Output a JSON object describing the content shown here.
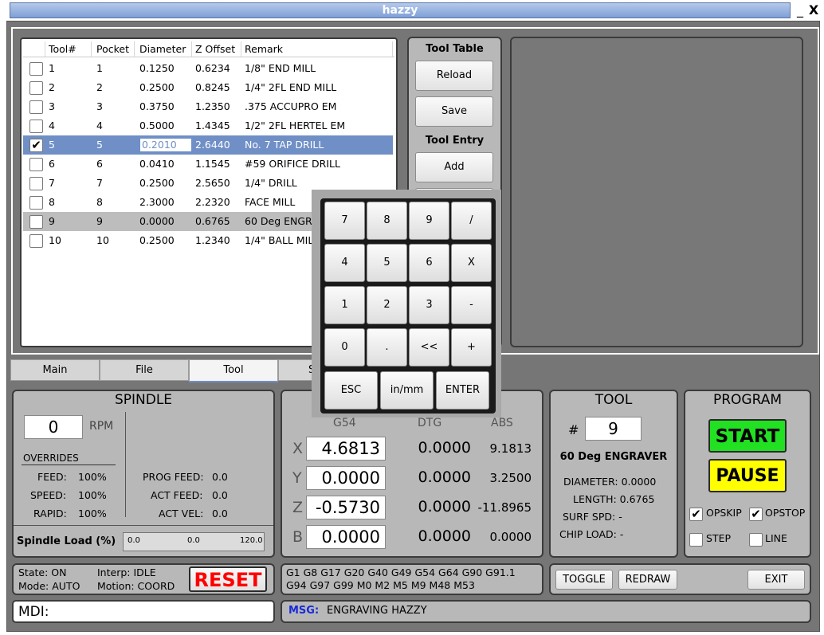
{
  "window": {
    "title": "hazzy",
    "minimize": "_",
    "close": "X"
  },
  "tool_table": {
    "headers": [
      "Tool#",
      "Pocket",
      "Diameter",
      "Z Offset",
      "Remark"
    ],
    "rows": [
      {
        "checked": false,
        "tool": "1",
        "pocket": "1",
        "diameter": "0.1250",
        "zoffset": "0.6234",
        "remark": "1/8\" END MILL"
      },
      {
        "checked": false,
        "tool": "2",
        "pocket": "2",
        "diameter": "0.2500",
        "zoffset": "0.8245",
        "remark": "1/4\" 2FL END MILL"
      },
      {
        "checked": false,
        "tool": "3",
        "pocket": "3",
        "diameter": "0.3750",
        "zoffset": "1.2350",
        "remark": ".375 ACCUPRO EM"
      },
      {
        "checked": false,
        "tool": "4",
        "pocket": "4",
        "diameter": "0.5000",
        "zoffset": "1.4345",
        "remark": "1/2\" 2FL HERTEL EM"
      },
      {
        "checked": true,
        "tool": "5",
        "pocket": "5",
        "diameter": "0.2010",
        "zoffset": "2.6440",
        "remark": "No. 7 TAP DRILL"
      },
      {
        "checked": false,
        "tool": "6",
        "pocket": "6",
        "diameter": "0.0410",
        "zoffset": "1.1545",
        "remark": "#59 ORIFICE DRILL"
      },
      {
        "checked": false,
        "tool": "7",
        "pocket": "7",
        "diameter": "0.2500",
        "zoffset": "2.5650",
        "remark": "1/4\" DRILL"
      },
      {
        "checked": false,
        "tool": "8",
        "pocket": "8",
        "diameter": "2.3000",
        "zoffset": "2.2320",
        "remark": "FACE MILL"
      },
      {
        "checked": false,
        "tool": "9",
        "pocket": "9",
        "diameter": "0.0000",
        "zoffset": "0.6765",
        "remark": "60 Deg ENGRAVER"
      },
      {
        "checked": false,
        "tool": "10",
        "pocket": "10",
        "diameter": "0.2500",
        "zoffset": "1.2340",
        "remark": "1/4\" BALL MILL"
      }
    ]
  },
  "tool_buttons": {
    "table_label": "Tool Table",
    "reload": "Reload",
    "save": "Save",
    "entry_label": "Tool Entry",
    "add": "Add"
  },
  "tabs": [
    "Main",
    "File",
    "Tool",
    "S"
  ],
  "keypad": {
    "rows": [
      [
        "7",
        "8",
        "9",
        "/"
      ],
      [
        "4",
        "5",
        "6",
        "X"
      ],
      [
        "1",
        "2",
        "3",
        "-"
      ],
      [
        "0",
        ".",
        "<<",
        "+"
      ]
    ],
    "bottom": [
      "ESC",
      "in/mm",
      "ENTER"
    ]
  },
  "spindle": {
    "title": "SPINDLE",
    "rpm_value": "0",
    "rpm_unit": "RPM",
    "overrides_label": "OVERRIDES",
    "feed_label": "FEED:",
    "feed_value": "100%",
    "speed_label": "SPEED:",
    "speed_value": "100%",
    "rapid_label": "RAPID:",
    "rapid_value": "100%",
    "prog_feed_label": "PROG FEED:",
    "prog_feed_value": "0.0",
    "act_feed_label": "ACT FEED:",
    "act_feed_value": "0.0",
    "act_vel_label": "ACT VEL:",
    "act_vel_value": "0.0",
    "load_label": "Spindle Load (%)",
    "load_min": "0.0",
    "load_mid": "0.0",
    "load_max": "120.0"
  },
  "dro": {
    "headers": [
      "G54",
      "DTG",
      "ABS"
    ],
    "axes": [
      {
        "axis": "X",
        "g54": "4.6813",
        "dtg": "0.0000",
        "abs": "9.1813"
      },
      {
        "axis": "Y",
        "g54": "0.0000",
        "dtg": "0.0000",
        "abs": "3.2500"
      },
      {
        "axis": "Z",
        "g54": "-0.5730",
        "dtg": "0.0000",
        "abs": "-11.8965"
      },
      {
        "axis": "B",
        "g54": "0.0000",
        "dtg": "0.0000",
        "abs": "0.0000"
      }
    ]
  },
  "tool_panel": {
    "title": "TOOL",
    "hash": "#",
    "number": "9",
    "name": "60 Deg ENGRAVER",
    "diameter": "DIAMETER: 0.0000",
    "length": "LENGTH: 0.6765",
    "surf_spd": "SURF SPD: -",
    "chip_load": "CHIP LOAD: -"
  },
  "program": {
    "title": "PROGRAM",
    "start": "START",
    "pause": "PAUSE",
    "opskip": "OPSKIP",
    "opskip_checked": true,
    "opstop": "OPSTOP",
    "opstop_checked": true,
    "step": "STEP",
    "step_checked": false,
    "line": "LINE",
    "line_checked": false
  },
  "status": {
    "state": "State: ON",
    "mode": "Mode: AUTO",
    "interp": "Interp: IDLE",
    "motion": "Motion: COORD",
    "reset": "RESET"
  },
  "gcodes": {
    "line1": "G1 G8 G17 G20 G40 G49 G54 G64 G90 G91.1",
    "line2": "G94 G97 G99 M0 M2 M5 M9 M48 M53"
  },
  "controls": {
    "toggle": "TOGGLE",
    "redraw": "REDRAW",
    "exit": "EXIT"
  },
  "mdi": {
    "label": "MDI:"
  },
  "message": {
    "label": "MSG:",
    "text": "ENGRAVING HAZZY"
  },
  "colors": {
    "start_bg": "#22e022",
    "pause_bg": "#ffff00",
    "reset_text": "#ff0000",
    "msg_label": "#1a2ad8",
    "selection": "#6f8fc6"
  }
}
